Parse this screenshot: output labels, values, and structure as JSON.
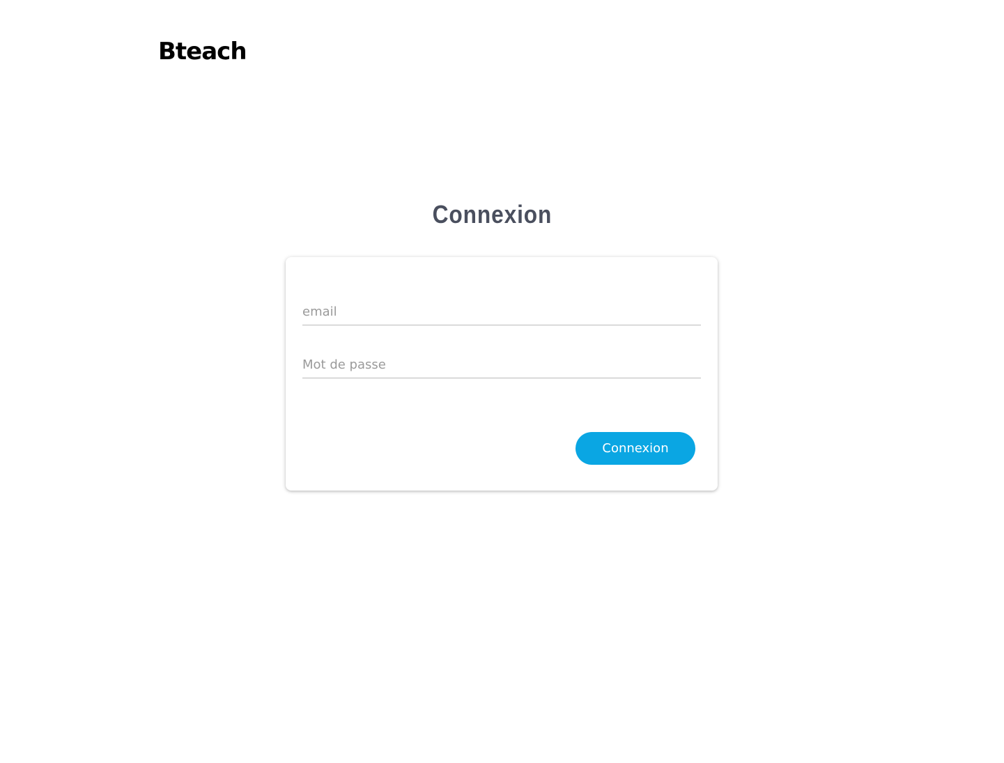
{
  "header": {
    "logo_text": "Bteach"
  },
  "main": {
    "title": "Connexion"
  },
  "login_form": {
    "email": {
      "value": "",
      "placeholder": "email"
    },
    "password": {
      "value": "",
      "placeholder": "Mot de passe"
    },
    "submit_label": "Connexion"
  },
  "colors": {
    "accent": "#0aa6e3",
    "title": "#4a4f5e",
    "placeholder": "#9a9a9a",
    "field_underline": "#b9b9b9"
  }
}
